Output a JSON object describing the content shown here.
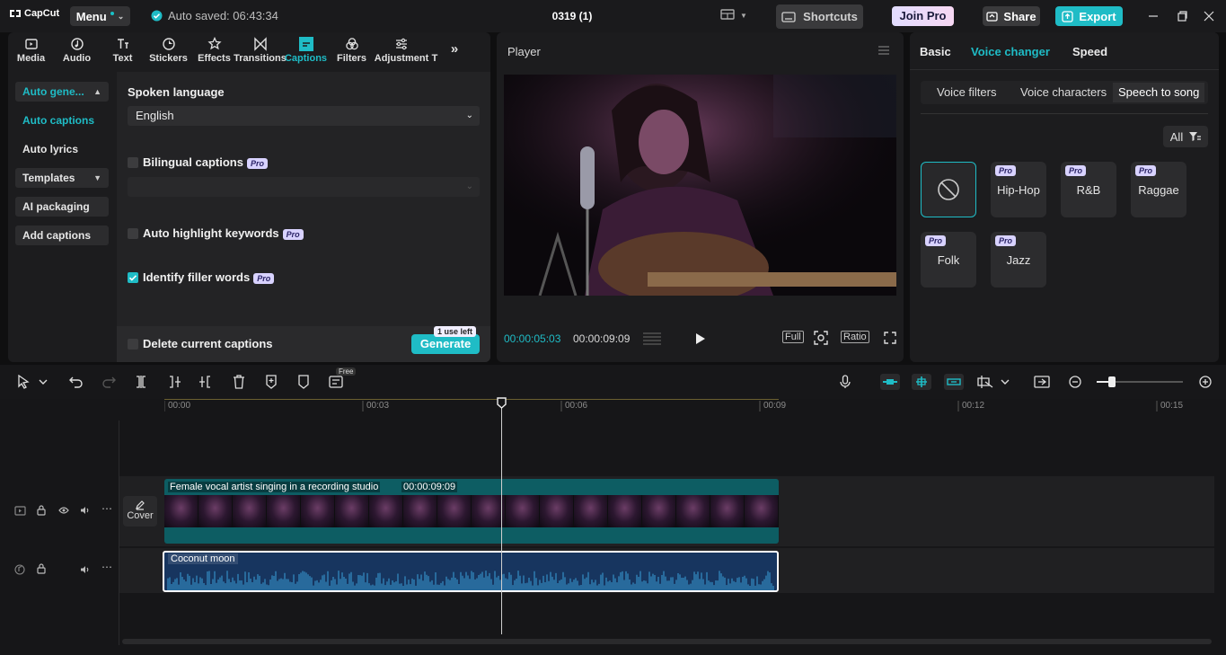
{
  "app": {
    "logo_text": "CapCut",
    "menu_label": "Menu",
    "autosave_text": "Auto saved: 06:43:34",
    "project_title": "0319 (1)",
    "shortcuts_label": "Shortcuts",
    "join_pro_label": "Join Pro",
    "share_label": "Share",
    "export_label": "Export",
    "accent_color": "#1fbcc6"
  },
  "toptabs": [
    {
      "label": "Media",
      "icon": "media-icon"
    },
    {
      "label": "Audio",
      "icon": "audio-icon"
    },
    {
      "label": "Text",
      "icon": "text-icon"
    },
    {
      "label": "Stickers",
      "icon": "stickers-icon"
    },
    {
      "label": "Effects",
      "icon": "effects-icon"
    },
    {
      "label": "Transitions",
      "icon": "transitions-icon"
    },
    {
      "label": "Captions",
      "icon": "captions-icon",
      "active": true
    },
    {
      "label": "Filters",
      "icon": "filters-icon"
    },
    {
      "label": "Adjustment",
      "icon": "adjustment-icon"
    },
    {
      "label": "T",
      "icon": ""
    }
  ],
  "captions_nav": {
    "auto_generate": "Auto gene...",
    "auto_captions": "Auto captions",
    "auto_lyrics": "Auto lyrics",
    "templates": "Templates",
    "ai_packaging": "AI packaging",
    "add_captions": "Add captions"
  },
  "captions_panel": {
    "spoken_language_label": "Spoken language",
    "spoken_language_value": "English",
    "bilingual_label": "Bilingual captions",
    "auto_highlight_label": "Auto highlight keywords",
    "filler_words_label": "Identify filler words",
    "delete_current_label": "Delete current captions",
    "generate_label": "Generate",
    "uses_left": "1 use left",
    "pro_badge": "Pro"
  },
  "player": {
    "title": "Player",
    "current_time": "00:00:05:03",
    "total_time": "00:00:09:09",
    "full_label": "Full",
    "ratio_label": "Ratio"
  },
  "right_panel": {
    "tabs": [
      "Basic",
      "Voice changer",
      "Speed"
    ],
    "active_tab": "Voice changer",
    "voice_tabs": [
      "Voice filters",
      "Voice characters",
      "Speech to song"
    ],
    "active_voice_tab": "Speech to song",
    "filter_label": "All",
    "cards": [
      {
        "name": "",
        "pro": false,
        "icon": "none-icon"
      },
      {
        "name": "Hip-Hop",
        "pro": true
      },
      {
        "name": "R&B",
        "pro": true
      },
      {
        "name": "Raggae",
        "pro": true
      },
      {
        "name": "Folk",
        "pro": true
      },
      {
        "name": "Jazz",
        "pro": true
      }
    ]
  },
  "toolbar": {
    "free_badge": "Free"
  },
  "timeline": {
    "ruler_labels": [
      "00:00",
      "00:03",
      "00:06",
      "00:09",
      "00:12",
      "00:15"
    ],
    "video_clip_title": "Female vocal artist singing in a recording studio",
    "video_clip_duration": "00:00:09:09",
    "audio_clip_title": "Coconut moon",
    "cover_label": "Cover"
  }
}
